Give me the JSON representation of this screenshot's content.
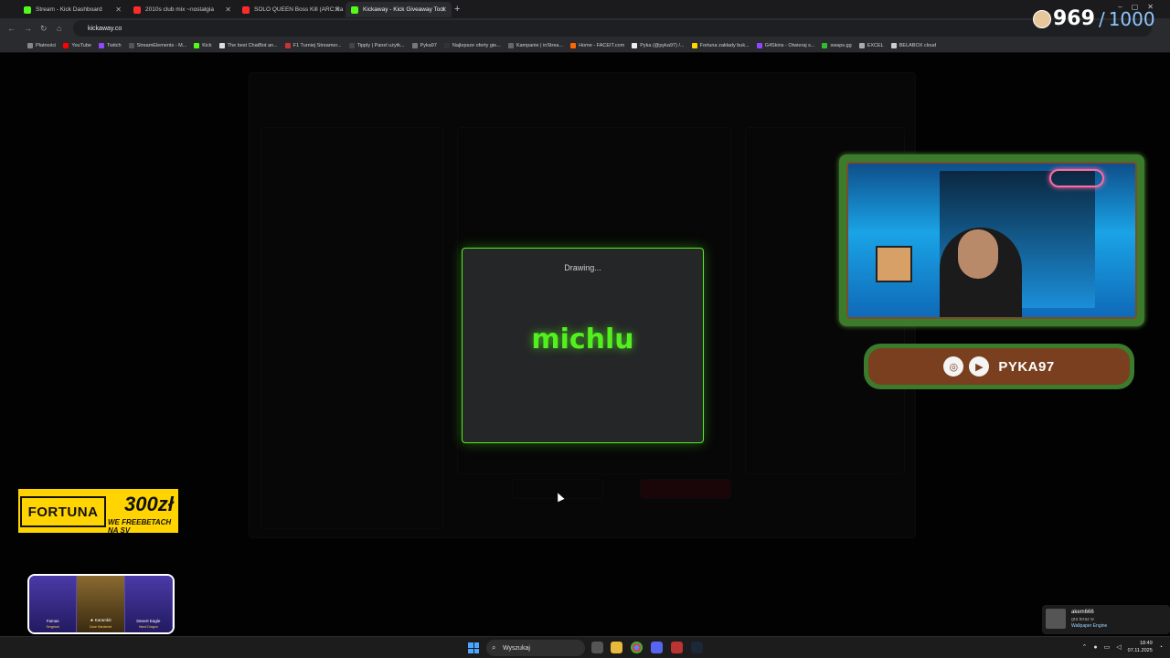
{
  "browser": {
    "tabs": [
      {
        "label": "Stream - Kick Dashboard",
        "color": "#53fc18"
      },
      {
        "label": "2010s club mix ~nostalgia",
        "color": "#ff0000"
      },
      {
        "label": "SOLO QUEEN Boss Kill (ARC Ra",
        "color": "#ff0000"
      },
      {
        "label": "Kickaway - Kick Giveaway Tool",
        "color": "#53fc18"
      }
    ],
    "url": "kickaway.co",
    "bookmarks": [
      "Płatności",
      "YouTube",
      "Twitch",
      "StreamElements - M...",
      "Kick",
      "The best ChatBot an...",
      "F1 Turniej Streamer...",
      "Tipply | Panel użytk...",
      "Pyka97",
      "Najlepsze oferty gie...",
      "Kampanie | inStrea...",
      "Home - FACEIT.com",
      "Pyka (@pyka97) /...",
      "Fortuna zakłady buk...",
      "G4Skins - Otwieraj s...",
      "swaps.gg",
      "EXCEL",
      "BELABOX cloud"
    ]
  },
  "modal": {
    "status": "Drawing...",
    "winner": "michlu"
  },
  "overlay": {
    "counter_current": "969",
    "counter_separator": "/",
    "counter_max": "1000",
    "handle": "PYKA97",
    "fortuna_logo": "FORTUNA",
    "fortuna_amount": "300zł",
    "fortuna_sub": "WE FREEBETACH NA SV",
    "skins": [
      {
        "name": "Famas",
        "sub": "Sergeant"
      },
      {
        "name": "★ Karambit",
        "sub": "Case Hardened"
      },
      {
        "name": "Desert Eagle",
        "sub": "Hand Dragon"
      }
    ]
  },
  "taskbar": {
    "search_placeholder": "Wyszukaj",
    "time": "18:49",
    "date": "07.11.2025"
  },
  "notification": {
    "user": "akem666",
    "line1": "gra teraz w",
    "line2": "Wallpaper Engine"
  },
  "colors": {
    "accent": "#53f020",
    "frame_wood": "#7a3f1e",
    "frame_grass": "#3c7a2c"
  }
}
